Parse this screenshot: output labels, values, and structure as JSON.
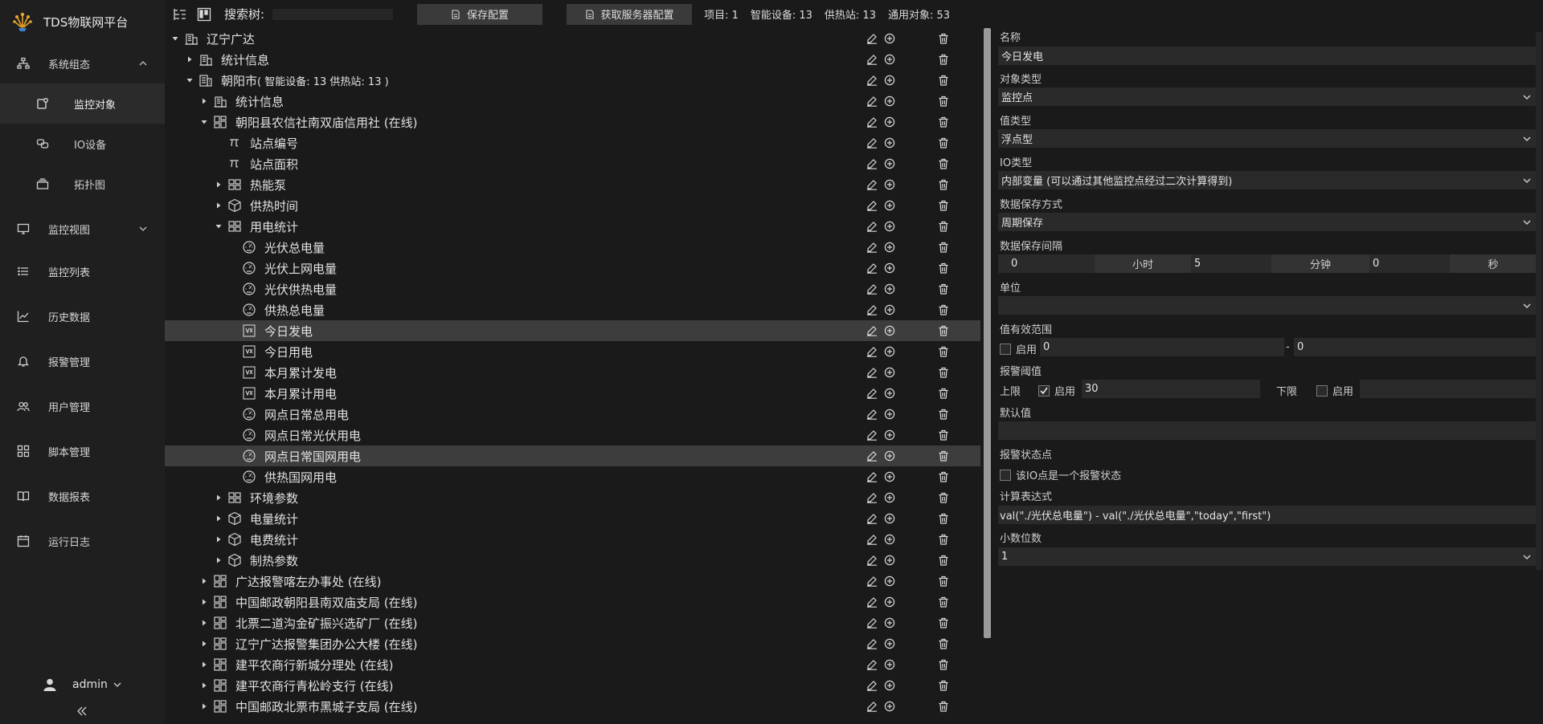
{
  "app": {
    "title": "TDS物联网平台"
  },
  "sidebar": {
    "groups": [
      {
        "label": "系统组态",
        "expanded": true,
        "children": [
          {
            "label": "监控对象",
            "active": true
          },
          {
            "label": "IO设备"
          },
          {
            "label": "拓扑图"
          }
        ]
      },
      {
        "label": "监控视图",
        "expanded": false
      }
    ],
    "items": [
      {
        "label": "监控列表"
      },
      {
        "label": "历史数据"
      },
      {
        "label": "报警管理"
      },
      {
        "label": "用户管理"
      },
      {
        "label": "脚本管理"
      },
      {
        "label": "数据报表"
      },
      {
        "label": "运行日志"
      }
    ],
    "user": "admin"
  },
  "toolbar": {
    "search_label": "搜索树:",
    "search_value": "",
    "save_label": "保存配置",
    "fetch_label": "获取服务器配置",
    "stats": [
      {
        "label": "项目: 1"
      },
      {
        "label": "智能设备: 13"
      },
      {
        "label": "供热站: 13"
      },
      {
        "label": "通用对象: 53"
      }
    ]
  },
  "tree": {
    "nodes": [
      {
        "label": "辽宁广达",
        "level": 0,
        "icon": "building",
        "arrow": "down"
      },
      {
        "label": "统计信息",
        "level": 1,
        "icon": "building",
        "arrow": "right"
      },
      {
        "label": "朝阳市",
        "suffix": "( 智能设备: 13   供热站: 13  )",
        "level": 1,
        "icon": "building-alt",
        "arrow": "down"
      },
      {
        "label": "统计信息",
        "level": 2,
        "icon": "building",
        "arrow": "right"
      },
      {
        "label": "朝阳县农信社南双庙信用社 (在线)",
        "level": 2,
        "icon": "station",
        "arrow": "down"
      },
      {
        "label": "站点编号",
        "level": 3,
        "icon": "pi",
        "arrow": "none"
      },
      {
        "label": "站点面积",
        "level": 3,
        "icon": "pi",
        "arrow": "none"
      },
      {
        "label": "热能泵",
        "level": 3,
        "icon": "grid",
        "arrow": "right"
      },
      {
        "label": "供热时间",
        "level": 3,
        "icon": "cube",
        "arrow": "right"
      },
      {
        "label": "用电统计",
        "level": 3,
        "icon": "grid",
        "arrow": "down"
      },
      {
        "label": "光伏总电量",
        "level": 4,
        "icon": "gauge",
        "arrow": "none"
      },
      {
        "label": "光伏上网电量",
        "level": 4,
        "icon": "gauge",
        "arrow": "none"
      },
      {
        "label": "光伏供热电量",
        "level": 4,
        "icon": "gauge",
        "arrow": "none"
      },
      {
        "label": "供热总电量",
        "level": 4,
        "icon": "gauge",
        "arrow": "none"
      },
      {
        "label": "今日发电",
        "level": 4,
        "icon": "var",
        "arrow": "none",
        "selected": true
      },
      {
        "label": "今日用电",
        "level": 4,
        "icon": "var",
        "arrow": "none"
      },
      {
        "label": "本月累计发电",
        "level": 4,
        "icon": "var",
        "arrow": "none"
      },
      {
        "label": "本月累计用电",
        "level": 4,
        "icon": "var",
        "arrow": "none"
      },
      {
        "label": "网点日常总用电",
        "level": 4,
        "icon": "gauge",
        "arrow": "none"
      },
      {
        "label": "网点日常光伏用电",
        "level": 4,
        "icon": "gauge",
        "arrow": "none"
      },
      {
        "label": "网点日常国网用电",
        "level": 4,
        "icon": "gauge",
        "arrow": "none",
        "selected": true
      },
      {
        "label": "供热国网用电",
        "level": 4,
        "icon": "gauge",
        "arrow": "none"
      },
      {
        "label": "环境参数",
        "level": 3,
        "icon": "grid",
        "arrow": "right"
      },
      {
        "label": "电量统计",
        "level": 3,
        "icon": "cube",
        "arrow": "right"
      },
      {
        "label": "电费统计",
        "level": 3,
        "icon": "cube",
        "arrow": "right"
      },
      {
        "label": "制热参数",
        "level": 3,
        "icon": "cube",
        "arrow": "right"
      },
      {
        "label": "广达报警喀左办事处 (在线)",
        "level": 2,
        "icon": "station",
        "arrow": "right"
      },
      {
        "label": "中国邮政朝阳县南双庙支局 (在线)",
        "level": 2,
        "icon": "station",
        "arrow": "right"
      },
      {
        "label": "北票二道沟金矿振兴选矿厂 (在线)",
        "level": 2,
        "icon": "station",
        "arrow": "right"
      },
      {
        "label": "辽宁广达报警集团办公大楼 (在线)",
        "level": 2,
        "icon": "station",
        "arrow": "right"
      },
      {
        "label": "建平农商行新城分理处 (在线)",
        "level": 2,
        "icon": "station",
        "arrow": "right"
      },
      {
        "label": "建平农商行青松岭支行 (在线)",
        "level": 2,
        "icon": "station",
        "arrow": "right"
      },
      {
        "label": "中国邮政北票市黑城子支局 (在线)",
        "level": 2,
        "icon": "station",
        "arrow": "right"
      }
    ]
  },
  "props": {
    "name_label": "名称",
    "name_value": "今日发电",
    "objtype_label": "对象类型",
    "objtype_value": "监控点",
    "valtype_label": "值类型",
    "valtype_value": "浮点型",
    "iotype_label": "IO类型",
    "iotype_value": "内部变量 (可以通过其他监控点经过二次计算得到)",
    "savemode_label": "数据保存方式",
    "savemode_value": "周期保存",
    "interval_label": "数据保存间隔",
    "interval": {
      "hours": "0",
      "hours_unit": "小时",
      "minutes": "5",
      "minutes_unit": "分钟",
      "seconds": "0",
      "seconds_unit": "秒"
    },
    "unit_label": "单位",
    "unit_value": "",
    "range_label": "值有效范围",
    "range": {
      "enable_label": "启用",
      "enabled": false,
      "min": "0",
      "sep": "-",
      "max": "0"
    },
    "alarm_label": "报警阈值",
    "alarm": {
      "upper_label": "上限",
      "upper_enable_label": "启用",
      "upper_enabled": true,
      "upper_value": "30",
      "lower_label": "下限",
      "lower_enable_label": "启用",
      "lower_enabled": false,
      "lower_value": ""
    },
    "default_label": "默认值",
    "default_value": "",
    "alarmstate_label": "报警状态点",
    "alarmstate_check_label": "该IO点是一个报警状态",
    "alarmstate_checked": false,
    "expr_label": "计算表达式",
    "expr_value": "val(\"./光伏总电量\")  - val(\"./光伏总电量\",\"today\",\"first\")",
    "decimals_label": "小数位数",
    "decimals_value": "1"
  },
  "colors": {
    "background": "#1a1a1a",
    "sidebar": "#1f1f1f",
    "selected_row": "#3d3d3d",
    "field": "#2a2a2a",
    "button": "#3a3a3a",
    "scrollbar": "#9a9a9a"
  }
}
